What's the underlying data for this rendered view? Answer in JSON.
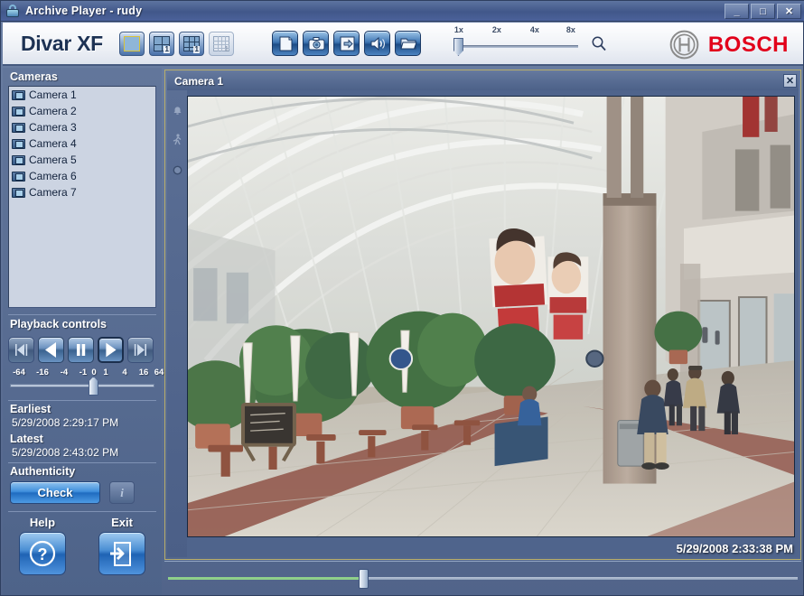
{
  "window": {
    "title": "Archive Player - rudy",
    "icon": "lock-icon",
    "minimize_label": "_",
    "maximize_label": "□",
    "close_label": "✕"
  },
  "header": {
    "brand": "Divar XF",
    "logo_text": "BOSCH",
    "logo_color": "#e2001a",
    "layout_buttons": [
      {
        "name": "layout-1x1",
        "cells": 1,
        "badge": "",
        "selected": true,
        "disabled": false
      },
      {
        "name": "layout-2x2",
        "cells": 4,
        "badge": "1",
        "selected": false,
        "disabled": false
      },
      {
        "name": "layout-3x3",
        "cells": 9,
        "badge": "1",
        "selected": false,
        "disabled": false
      },
      {
        "name": "layout-4x4",
        "cells": 16,
        "badge": "1",
        "selected": false,
        "disabled": true
      }
    ],
    "tool_buttons": [
      {
        "name": "report-icon",
        "label": "Report"
      },
      {
        "name": "snapshot-camera-icon",
        "label": "Snapshot"
      },
      {
        "name": "export-save-icon",
        "label": "Export"
      },
      {
        "name": "audio-speaker-icon",
        "label": "Audio"
      },
      {
        "name": "open-folder-icon",
        "label": "Open"
      }
    ],
    "zoom": {
      "ticks": [
        "1x",
        "2x",
        "4x",
        "8x"
      ],
      "value": "1x",
      "magnifier_icon": "search-icon"
    }
  },
  "sidebar": {
    "cameras_title": "Cameras",
    "cameras": [
      {
        "label": "Camera 1"
      },
      {
        "label": "Camera 2"
      },
      {
        "label": "Camera 3"
      },
      {
        "label": "Camera 4"
      },
      {
        "label": "Camera 5"
      },
      {
        "label": "Camera 6"
      },
      {
        "label": "Camera 7"
      }
    ],
    "playback_title": "Playback controls",
    "playback_buttons": [
      {
        "name": "step-back-button",
        "icon": "step-backward-icon",
        "state": "dim"
      },
      {
        "name": "reverse-play-button",
        "icon": "play-reverse-icon",
        "state": "normal"
      },
      {
        "name": "pause-button",
        "icon": "pause-icon",
        "state": "normal"
      },
      {
        "name": "play-button",
        "icon": "play-icon",
        "state": "active"
      },
      {
        "name": "step-forward-button",
        "icon": "step-forward-icon",
        "state": "dim"
      }
    ],
    "speed_ticks": [
      "-64",
      "-16",
      "-4",
      "-1",
      "0",
      "1",
      "4",
      "16",
      "64"
    ],
    "speed_value": "1",
    "earliest_label": "Earliest",
    "earliest_value": "5/29/2008 2:29:17 PM",
    "latest_label": "Latest",
    "latest_value": "5/29/2008 2:43:02 PM",
    "authenticity_label": "Authenticity",
    "check_label": "Check",
    "info_label": "i",
    "help_label": "Help",
    "exit_label": "Exit"
  },
  "video": {
    "title": "Camera 1",
    "close_label": "✕",
    "timestamp": "5/29/2008 2:33:38 PM",
    "indicators": [
      {
        "name": "alarm-icon"
      },
      {
        "name": "motion-icon"
      },
      {
        "name": "record-dot-icon"
      }
    ]
  },
  "timeline": {
    "position_percent": 31
  }
}
